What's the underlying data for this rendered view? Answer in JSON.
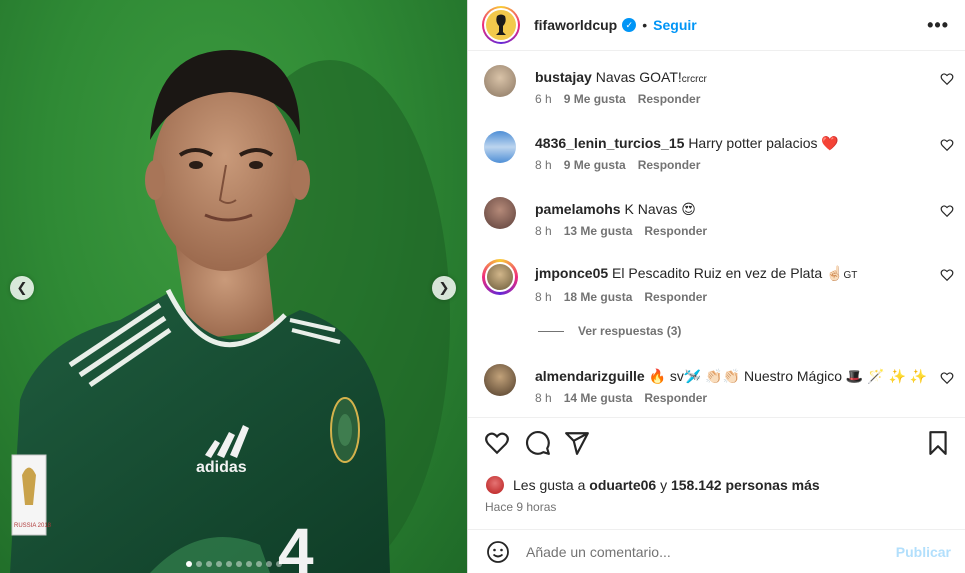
{
  "post": {
    "account": "fifaworldcup",
    "follow_label": "Seguir",
    "separator": "•",
    "more_label": "•••",
    "jersey_number": "4",
    "kit_brand": "adidas",
    "badge_text": "RUSSIA 2018",
    "carousel": {
      "total": 10,
      "active": 0
    }
  },
  "comments": [
    {
      "user": "bustajay",
      "text": "Navas GOAT!",
      "suffix": "crcrcr",
      "time": "6 h",
      "likes": "9 Me gusta",
      "reply": "Responder"
    },
    {
      "user": "4836_lenin_turcios_15",
      "text": "Harry potter palacios ❤️",
      "suffix": "",
      "time": "8 h",
      "likes": "9 Me gusta",
      "reply": "Responder"
    },
    {
      "user": "pamelamohs",
      "text": "K Navas 😍",
      "suffix": "",
      "time": "8 h",
      "likes": "13 Me gusta",
      "reply": "Responder"
    },
    {
      "user": "jmponce05",
      "text": "El Pescadito Ruiz en vez de Plata ☝🏻",
      "suffix": "GT",
      "time": "8 h",
      "likes": "18 Me gusta",
      "reply": "Responder"
    },
    {
      "user": "almendarizguille",
      "text": "🔥 sv🛩️ 👏🏻👏🏻 Nuestro Mágico 🎩 🪄 ✨ ✨",
      "suffix": "",
      "time": "8 h",
      "likes": "14 Me gusta",
      "reply": "Responder"
    }
  ],
  "view_replies": "Ver respuestas (3)",
  "likes": {
    "prefix": "Les gusta a",
    "user": "oduarte06",
    "conj": "y",
    "others": "158.142 personas más"
  },
  "posted": "Hace 9 horas",
  "composer": {
    "placeholder": "Añade un comentario...",
    "publish": "Publicar"
  },
  "colors": {
    "accent": "#0095f6",
    "publish_disabled": "#b2dffc",
    "muted": "#737373",
    "heart_red": "#ed4956"
  }
}
